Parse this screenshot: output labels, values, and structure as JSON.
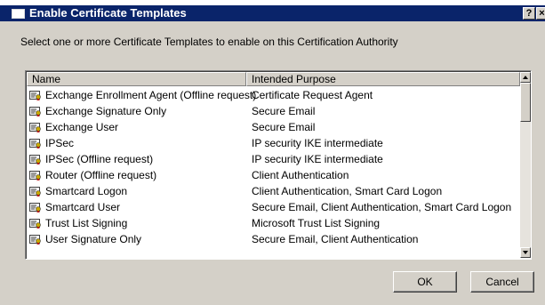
{
  "window": {
    "title": "Enable Certificate Templates",
    "help_label": "?",
    "close_label": "×"
  },
  "instruction": "Select one or more Certificate Templates to enable on this Certification Authority",
  "list": {
    "columns": {
      "name": "Name",
      "purpose": "Intended Purpose"
    },
    "rows": [
      {
        "name": "Exchange Enrollment Agent (Offline request)",
        "purpose": "Certificate Request Agent"
      },
      {
        "name": "Exchange Signature Only",
        "purpose": "Secure Email"
      },
      {
        "name": "Exchange User",
        "purpose": "Secure Email"
      },
      {
        "name": "IPSec",
        "purpose": "IP security IKE intermediate"
      },
      {
        "name": "IPSec (Offline request)",
        "purpose": "IP security IKE intermediate"
      },
      {
        "name": "Router (Offline request)",
        "purpose": "Client Authentication"
      },
      {
        "name": "Smartcard Logon",
        "purpose": "Client Authentication, Smart Card Logon"
      },
      {
        "name": "Smartcard User",
        "purpose": "Secure Email, Client Authentication, Smart Card Logon"
      },
      {
        "name": "Trust List Signing",
        "purpose": "Microsoft Trust List Signing"
      },
      {
        "name": "User Signature Only",
        "purpose": "Secure Email, Client Authentication"
      }
    ],
    "row_icon": "certificate-template-icon"
  },
  "buttons": {
    "ok": "OK",
    "cancel": "Cancel"
  },
  "colors": {
    "titlebar": "#0a246a",
    "dialog": "#d4d0c8"
  }
}
